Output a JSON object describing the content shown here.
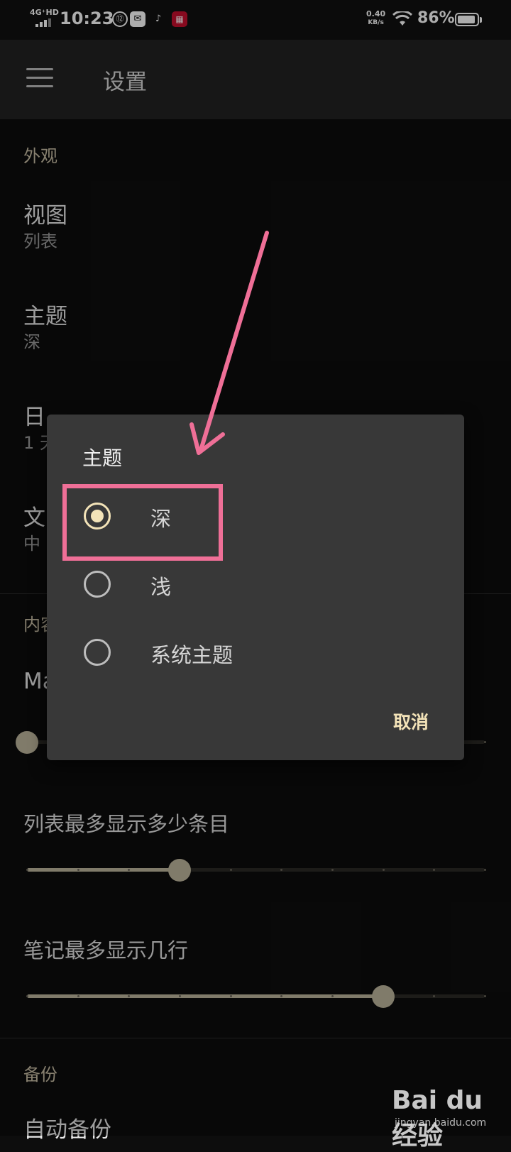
{
  "status_bar": {
    "network": "4G⁺HD",
    "time": "10:23",
    "net_speed_value": "0.40",
    "net_speed_unit": "KB/s",
    "battery_percent": "86%",
    "icons": [
      "shield-icon",
      "mail-icon",
      "tiktok-icon",
      "grid-app-icon"
    ]
  },
  "app_bar": {
    "title": "设置",
    "menu_icon": "hamburger-menu-icon"
  },
  "sections": {
    "appearance": "外观",
    "content_partial": "内容",
    "backup": "备份"
  },
  "prefs": {
    "view": {
      "title": "视图",
      "summary": "列表"
    },
    "theme": {
      "title": "主题",
      "summary": "深"
    },
    "date": {
      "title": "日",
      "summary": "1 天"
    },
    "text": {
      "title": "文",
      "summary": "中"
    },
    "ma_partial": {
      "title": "Ma"
    },
    "auto_backup": {
      "title": "自动备份"
    }
  },
  "sliders": {
    "ma": {
      "value_fraction": 0.0,
      "ticks": 10
    },
    "list_max": {
      "label": "列表最多显示多少条目",
      "value_fraction": 0.333,
      "ticks": 10
    },
    "note_lines": {
      "label": "笔记最多显示几行",
      "value_fraction": 0.778,
      "ticks": 10
    }
  },
  "dialog": {
    "title": "主题",
    "options": [
      {
        "label": "深",
        "checked": true
      },
      {
        "label": "浅",
        "checked": false
      },
      {
        "label": "系统主题",
        "checked": false
      }
    ],
    "cancel_label": "取消"
  },
  "colors": {
    "accent": "#f3e3b8",
    "annotation": "#ef6f97",
    "section_header": "#c9bfa6"
  },
  "watermark": {
    "text": "Bai du 经验",
    "url": "jingyan.baidu.com"
  }
}
